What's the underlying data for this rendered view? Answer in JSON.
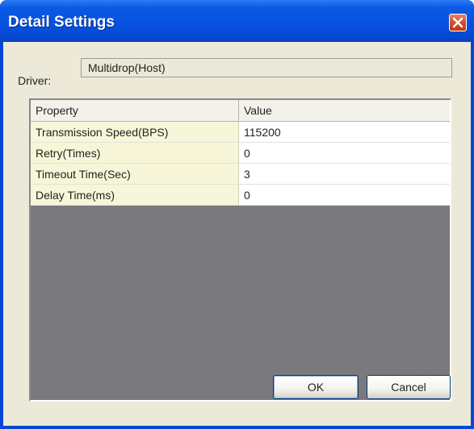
{
  "window": {
    "title": "Detail Settings",
    "close_icon": "close-icon"
  },
  "driver": {
    "label": "Driver:",
    "value": "Multidrop(Host)"
  },
  "grid": {
    "columns": {
      "property": "Property",
      "value": "Value"
    },
    "rows": [
      {
        "property": "Transmission Speed(BPS)",
        "value": "115200"
      },
      {
        "property": "Retry(Times)",
        "value": "0"
      },
      {
        "property": "Timeout Time(Sec)",
        "value": "3"
      },
      {
        "property": "Delay Time(ms)",
        "value": "0"
      }
    ]
  },
  "buttons": {
    "ok_label": "OK",
    "cancel_label": "Cancel"
  },
  "colors": {
    "titlebar": "#0754e2",
    "client_bg": "#ece9d8",
    "property_cell_bg": "#f7f6d8",
    "grid_empty_bg": "#7a7a7c"
  }
}
